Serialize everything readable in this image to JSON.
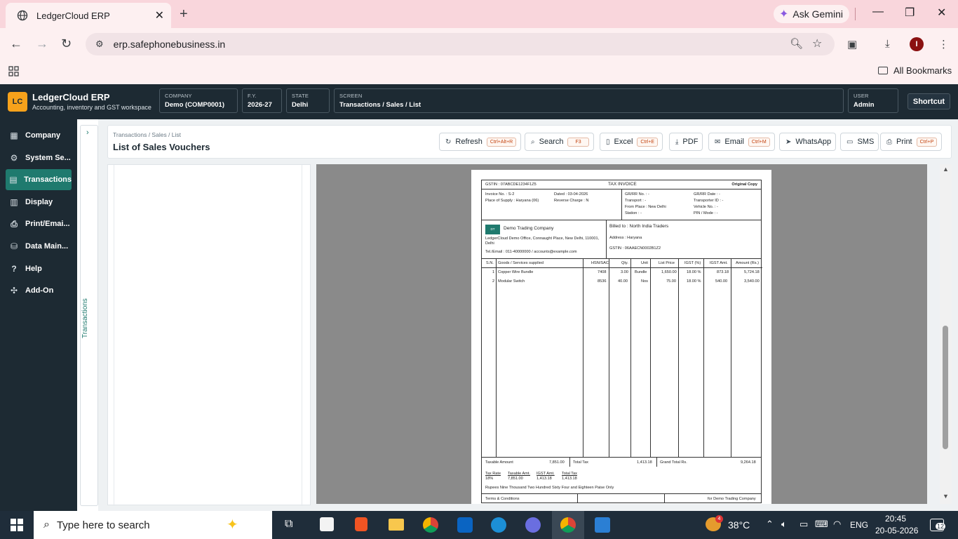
{
  "browser": {
    "tab_title": "LedgerCloud ERP",
    "url": "erp.safephonebusiness.in",
    "gemini_label": "Ask Gemini",
    "all_bookmarks": "All Bookmarks",
    "profile_initial": "I"
  },
  "app": {
    "logo": "LC",
    "name": "LedgerCloud ERP",
    "tagline": "Accounting, inventory and GST workspace",
    "header_fields": [
      {
        "label": "COMPANY",
        "value": "Demo (COMP0001)"
      },
      {
        "label": "F.Y.",
        "value": "2026-27"
      },
      {
        "label": "STATE",
        "value": "Delhi"
      },
      {
        "label": "SCREEN",
        "value": "Transactions / Sales / List"
      },
      {
        "label": "USER",
        "value": "Admin"
      }
    ],
    "shortcut_label": "Shortcut"
  },
  "sidebar": {
    "items": [
      {
        "label": "Company",
        "icon": "building-icon"
      },
      {
        "label": "System Se...",
        "icon": "gear-icon"
      },
      {
        "label": "Transactions",
        "icon": "ledger-icon"
      },
      {
        "label": "Display",
        "icon": "bar-chart-icon"
      },
      {
        "label": "Print/Emai...",
        "icon": "printer-icon"
      },
      {
        "label": "Data Main...",
        "icon": "database-icon"
      },
      {
        "label": "Help",
        "icon": "help-icon"
      },
      {
        "label": "Add-On",
        "icon": "puzzle-icon"
      }
    ],
    "active_index": 2,
    "collapsed_label": "Transactions"
  },
  "page": {
    "breadcrumb": "Transactions / Sales / List",
    "title": "List of Sales Vouchers",
    "actions": [
      {
        "label": "Refresh",
        "shortcut": "Ctrl+Alt+R",
        "icon": "refresh-icon"
      },
      {
        "label": "Search",
        "shortcut": "F3",
        "icon": "search-icon"
      },
      {
        "label": "Excel",
        "shortcut": "Ctrl+E",
        "icon": "file-icon"
      },
      {
        "label": "PDF",
        "shortcut": "",
        "icon": "download-icon"
      },
      {
        "label": "Email",
        "shortcut": "Ctrl+M",
        "icon": "mail-icon"
      },
      {
        "label": "WhatsApp",
        "shortcut": "",
        "icon": "send-icon"
      },
      {
        "label": "SMS",
        "shortcut": "",
        "icon": "chat-icon"
      },
      {
        "label": "Print",
        "shortcut": "Ctrl+P",
        "icon": "printer-icon"
      }
    ]
  },
  "invoice": {
    "gstin": "GSTIN : 07ABCDE1234F1Z5",
    "title": "TAX INVOICE",
    "copy": "Original Copy",
    "invoice_no": "Invoice No. : S-2",
    "dated": "Dated : 03-04-2026",
    "place_of_supply": "Place of Supply : Haryana (06)",
    "reverse_charge": "Reverse Charge : N",
    "gr_no": "GR/RR No. : -",
    "transport": "Transport : -",
    "from_place": "From Place : New Delhi",
    "station": "Station : -",
    "gr_date": "GR/RR Date : -",
    "transporter_id": "Transporter ID : -",
    "vehicle_no": "Vehicle No. : -",
    "pin_mode": "PIN / Mode : -",
    "logo_text": "DT",
    "company_name": "Demo Trading Company",
    "company_address": "LedgerCloud Demo Office, Connaught Place, New Delhi, 110001, Delhi",
    "company_contact": "Tel./Email : 011-40000000 / accounts@example.com",
    "billed_to": "Billed to : North India Traders",
    "billed_address": "Address : Haryana",
    "billed_gstin": "GSTIN : 06AAECN0002B1Z2",
    "columns": [
      "S.N.",
      "Goods / Services supplied",
      "HSN/SAC",
      "Qty.",
      "Unit",
      "List Price",
      "IGST (%)",
      "IGST Amt.",
      "Amount (Rs.)"
    ],
    "rows": [
      [
        "1",
        "Copper Wire Bundle",
        "7408",
        "3.00",
        "Bundle",
        "1,650.00",
        "18.00 %",
        "873.18",
        "5,724.18"
      ],
      [
        "2",
        "Modular Switch",
        "8536",
        "40.00",
        "Nos",
        "75.00",
        "18.00 %",
        "540.00",
        "3,540.00"
      ]
    ],
    "taxable_amount_label": "Taxable Amount",
    "taxable_amount": "7,851.00",
    "total_tax_label": "Total Tax",
    "total_tax": "1,413.18",
    "grand_total_label": "Grand Total Rs.",
    "grand_total": "9,264.18",
    "tax_summary_headers": [
      "Tax Rate",
      "Taxable Amt.",
      "IGST Amt.",
      "Total Tax"
    ],
    "tax_summary_row": [
      "18%",
      "7,851.00",
      "1,413.18",
      "1,413.18"
    ],
    "amount_in_words": "Rupees Nine Thousand Two Hundred Sixty Four and Eighteen Paise Only",
    "terms_label": "Terms & Conditions",
    "for_company": "for Demo Trading Company"
  },
  "taskbar": {
    "search_placeholder": "Type here to search",
    "temperature": "38°C",
    "language": "ENG",
    "time": "20:45",
    "date": "20-05-2026",
    "notification_count": "12",
    "weather_badge": "4"
  }
}
